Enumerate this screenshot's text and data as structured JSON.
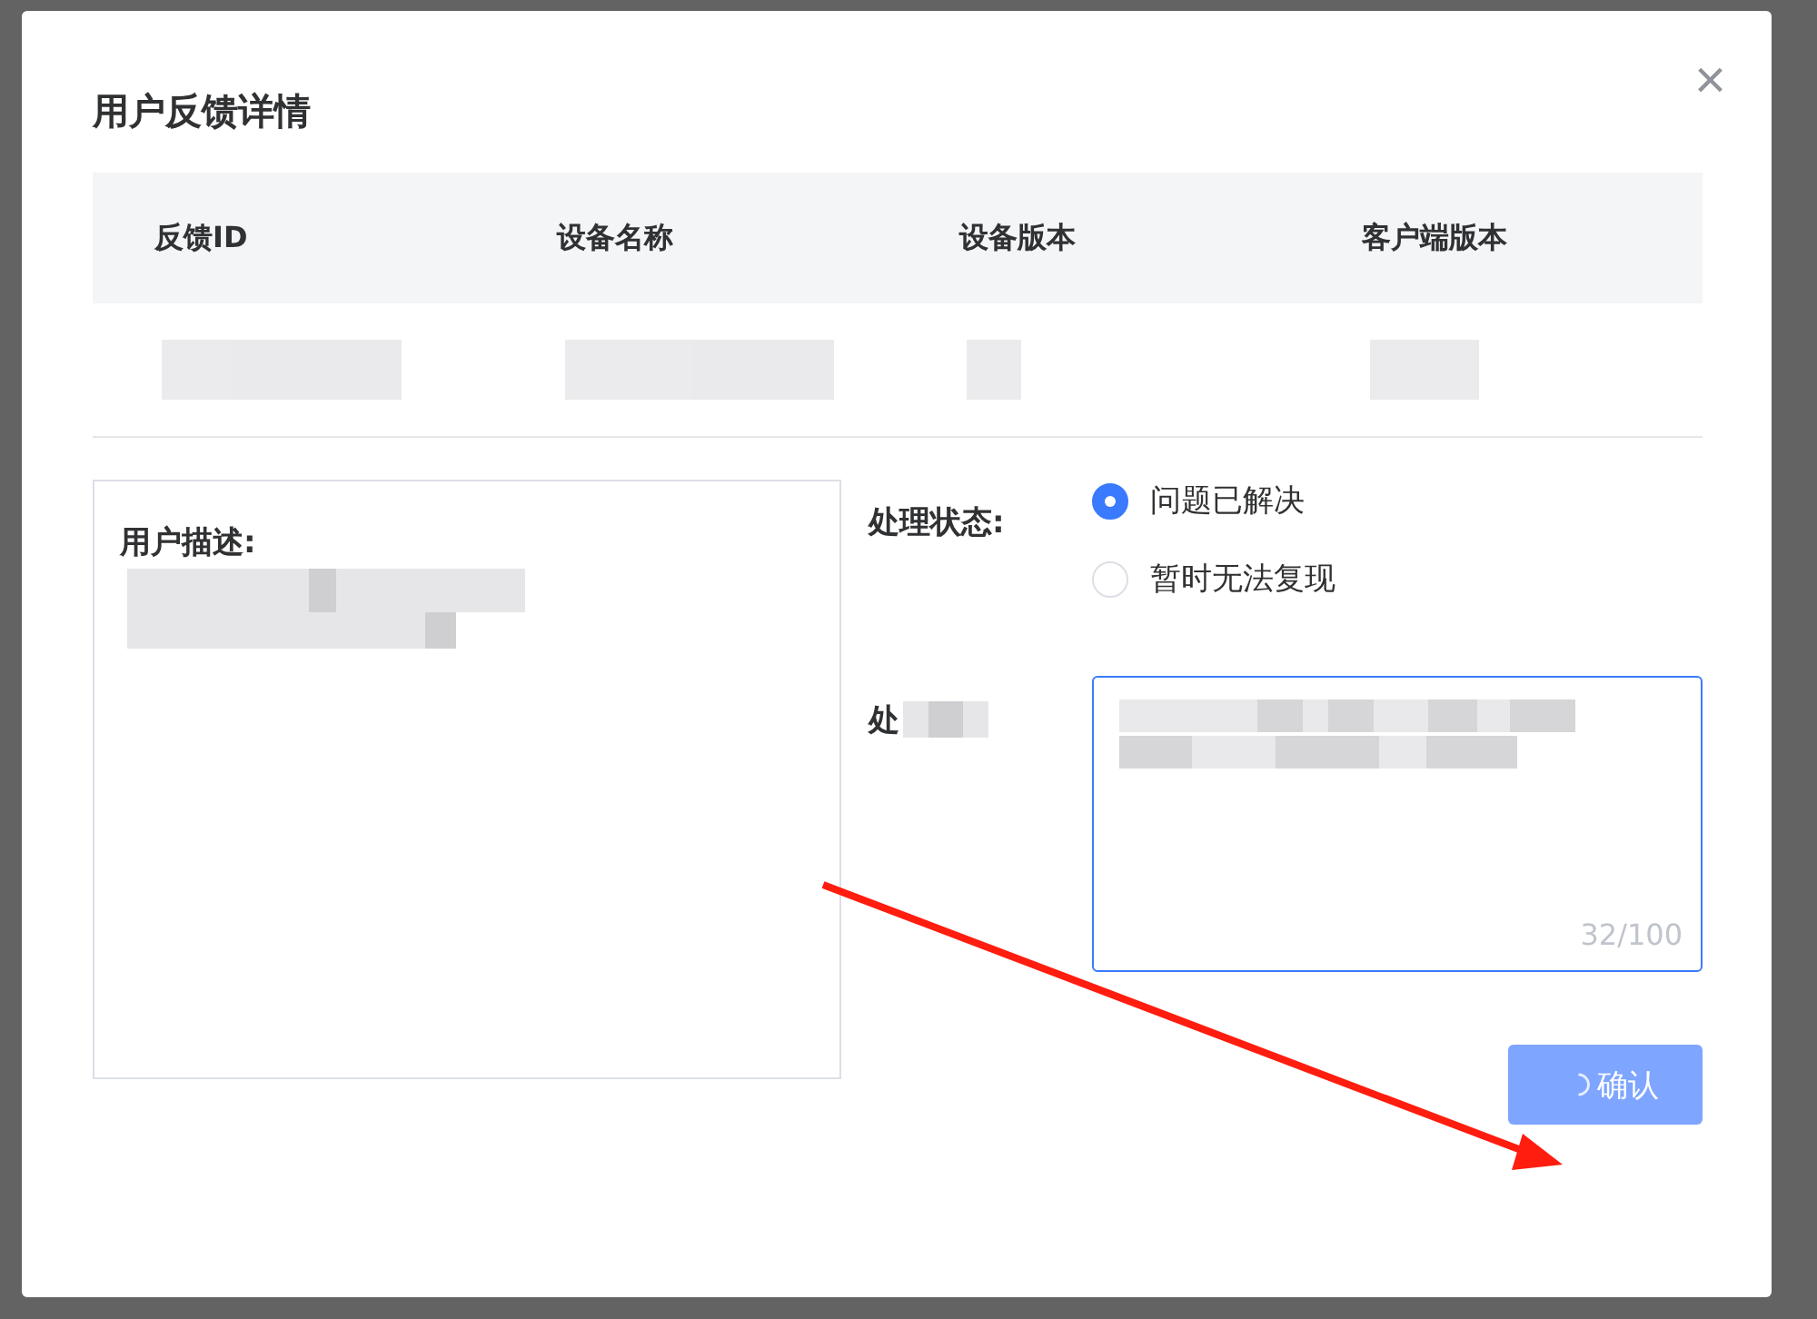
{
  "dialog": {
    "title": "用户反馈详情",
    "close": "×"
  },
  "table": {
    "columns": [
      "反馈ID",
      "设备名称",
      "设备版本",
      "客户端版本"
    ]
  },
  "description": {
    "label": "用户描述:"
  },
  "status": {
    "label": "处理状态:",
    "options": [
      {
        "label": "问题已解决",
        "selected": true
      },
      {
        "label": "暂时无法复现",
        "selected": false
      }
    ]
  },
  "note": {
    "label": "处",
    "counter": "32/100"
  },
  "confirm": {
    "label": "确认",
    "loading": true
  }
}
